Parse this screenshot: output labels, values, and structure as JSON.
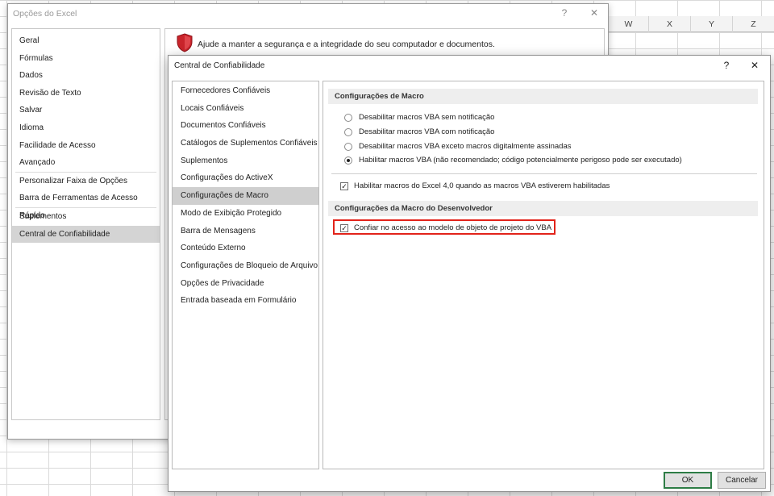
{
  "excel_columns": [
    "W",
    "X",
    "Y",
    "Z"
  ],
  "options_window": {
    "title": "Opções do Excel",
    "help_glyph": "?",
    "close_glyph": "✕",
    "shield_text": "Ajude a manter a segurança e a integridade do seu computador e documentos.",
    "sidebar": [
      "Geral",
      "Fórmulas",
      "Dados",
      "Revisão de Texto",
      "Salvar",
      "Idioma",
      "Facilidade de Acesso",
      "Avançado",
      "Personalizar Faixa de Opções",
      "Barra de Ferramentas de Acesso Rápido",
      "Suplementos",
      "Central de Confiabilidade"
    ]
  },
  "trust_center": {
    "title": "Central de Confiabilidade",
    "help_glyph": "?",
    "close_glyph": "✕",
    "sidebar": [
      "Fornecedores Confiáveis",
      "Locais Confiáveis",
      "Documentos Confiáveis",
      "Catálogos de Suplementos Confiáveis",
      "Suplementos",
      "Configurações do ActiveX",
      "Configurações de Macro",
      "Modo de Exibição Protegido",
      "Barra de Mensagens",
      "Conteúdo Externo",
      "Configurações de Bloqueio de Arquivo",
      "Opções de Privacidade",
      "Entrada baseada em Formulário"
    ],
    "selected_item": "Configurações de Macro",
    "macro_section_title": "Configurações de Macro",
    "radio_options": [
      {
        "label": "Desabilitar macros VBA sem notificação",
        "selected": false
      },
      {
        "label": "Desabilitar macros VBA com notificação",
        "selected": false
      },
      {
        "label": "Desabilitar macros VBA exceto macros digitalmente assinadas",
        "selected": false
      },
      {
        "label": "Habilitar macros VBA (não recomendado; código potencialmente perigoso pode ser executado)",
        "selected": true
      }
    ],
    "excel4_checkbox": {
      "label": "Habilitar macros do Excel 4,0 quando as macros VBA estiverem habilitadas",
      "checked": true
    },
    "developer_section_title": "Configurações da Macro do Desenvolvedor",
    "vba_trust_checkbox": {
      "label": "Confiar no acesso ao modelo de objeto de projeto do VBA",
      "checked": true
    },
    "ok_label": "OK",
    "cancel_label": "Cancelar"
  },
  "colors": {
    "highlight": "#e2231a",
    "shield": "#c9242b",
    "ok_border": "#2e7d46"
  }
}
